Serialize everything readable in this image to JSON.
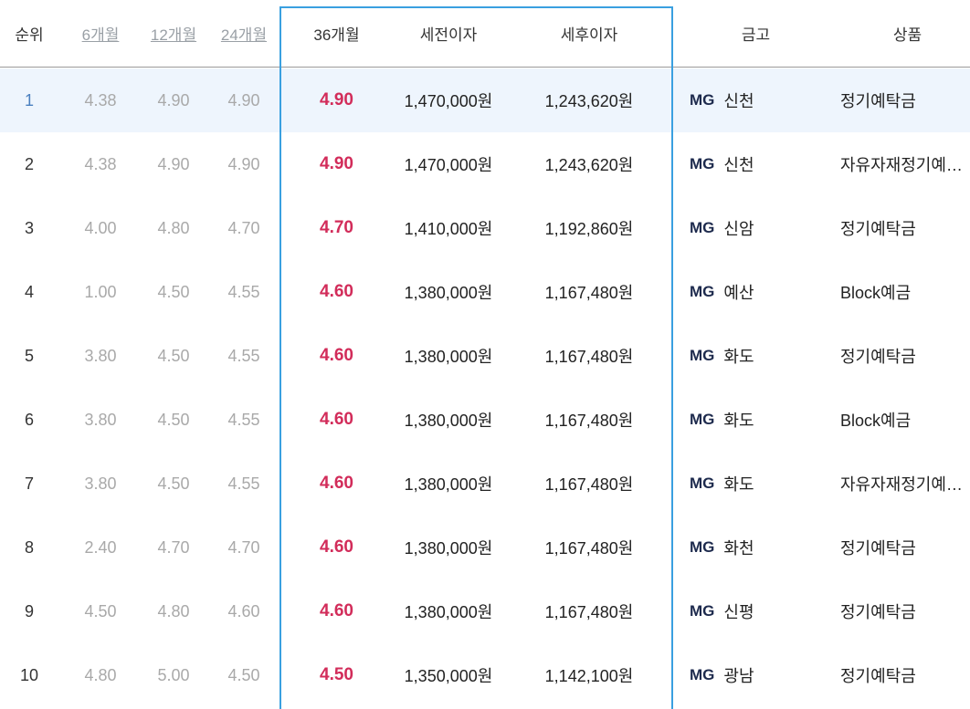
{
  "headers": {
    "rank": "순위",
    "m6": "6개월",
    "m12": "12개월",
    "m24": "24개월",
    "m36": "36개월",
    "pre_tax": "세전이자",
    "post_tax": "세후이자",
    "bank": "금고",
    "product": "상품"
  },
  "rows": [
    {
      "rank": "1",
      "m6": "4.38",
      "m12": "4.90",
      "m24": "4.90",
      "m36": "4.90",
      "pre_tax": "1,470,000원",
      "post_tax": "1,243,620원",
      "bank_badge": "MG",
      "bank": "신천",
      "product": "정기예탁금"
    },
    {
      "rank": "2",
      "m6": "4.38",
      "m12": "4.90",
      "m24": "4.90",
      "m36": "4.90",
      "pre_tax": "1,470,000원",
      "post_tax": "1,243,620원",
      "bank_badge": "MG",
      "bank": "신천",
      "product": "자유자재정기예…"
    },
    {
      "rank": "3",
      "m6": "4.00",
      "m12": "4.80",
      "m24": "4.70",
      "m36": "4.70",
      "pre_tax": "1,410,000원",
      "post_tax": "1,192,860원",
      "bank_badge": "MG",
      "bank": "신암",
      "product": "정기예탁금"
    },
    {
      "rank": "4",
      "m6": "1.00",
      "m12": "4.50",
      "m24": "4.55",
      "m36": "4.60",
      "pre_tax": "1,380,000원",
      "post_tax": "1,167,480원",
      "bank_badge": "MG",
      "bank": "예산",
      "product": "Block예금"
    },
    {
      "rank": "5",
      "m6": "3.80",
      "m12": "4.50",
      "m24": "4.55",
      "m36": "4.60",
      "pre_tax": "1,380,000원",
      "post_tax": "1,167,480원",
      "bank_badge": "MG",
      "bank": "화도",
      "product": "정기예탁금"
    },
    {
      "rank": "6",
      "m6": "3.80",
      "m12": "4.50",
      "m24": "4.55",
      "m36": "4.60",
      "pre_tax": "1,380,000원",
      "post_tax": "1,167,480원",
      "bank_badge": "MG",
      "bank": "화도",
      "product": "Block예금"
    },
    {
      "rank": "7",
      "m6": "3.80",
      "m12": "4.50",
      "m24": "4.55",
      "m36": "4.60",
      "pre_tax": "1,380,000원",
      "post_tax": "1,167,480원",
      "bank_badge": "MG",
      "bank": "화도",
      "product": "자유자재정기예…"
    },
    {
      "rank": "8",
      "m6": "2.40",
      "m12": "4.70",
      "m24": "4.70",
      "m36": "4.60",
      "pre_tax": "1,380,000원",
      "post_tax": "1,167,480원",
      "bank_badge": "MG",
      "bank": "화천",
      "product": "정기예탁금"
    },
    {
      "rank": "9",
      "m6": "4.50",
      "m12": "4.80",
      "m24": "4.60",
      "m36": "4.60",
      "pre_tax": "1,380,000원",
      "post_tax": "1,167,480원",
      "bank_badge": "MG",
      "bank": "신평",
      "product": "정기예탁금"
    },
    {
      "rank": "10",
      "m6": "4.80",
      "m12": "5.00",
      "m24": "4.50",
      "m36": "4.50",
      "pre_tax": "1,350,000원",
      "post_tax": "1,142,100원",
      "bank_badge": "MG",
      "bank": "광남",
      "product": "정기예탁금"
    }
  ],
  "colors": {
    "accent_border": "#3aa0e0",
    "highlight_rate": "#d22c5a",
    "selected_row_bg": "#eef5fd",
    "muted_text": "#a9a9a9"
  }
}
